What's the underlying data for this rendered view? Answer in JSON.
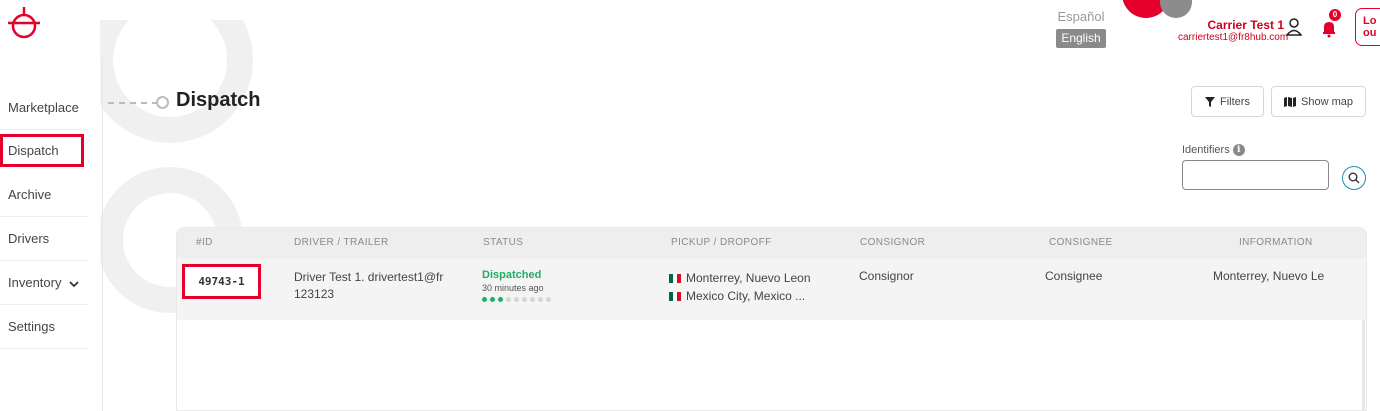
{
  "header": {
    "lang_es": "Español",
    "lang_en": "English",
    "user_name": "Carrier Test 1",
    "user_email": "carriertest1@fr8hub.com",
    "notification_count": "0",
    "logout_label": "Lo\nou"
  },
  "sidebar": {
    "items": [
      {
        "label": "Marketplace"
      },
      {
        "label": "Dispatch"
      },
      {
        "label": "Archive"
      },
      {
        "label": "Drivers"
      },
      {
        "label": "Inventory"
      },
      {
        "label": "Settings"
      }
    ]
  },
  "main": {
    "title": "Dispatch",
    "filters_label": "Filters",
    "map_label": "Show map",
    "identifiers_label": "Identifiers",
    "identifiers_value": ""
  },
  "table": {
    "headers": [
      "#ID",
      "DRIVER / TRAILER",
      "STATUS",
      "PICKUP / DROPOFF",
      "CONSIGNOR",
      "CONSIGNEE",
      "INFORMATION"
    ],
    "rows": [
      {
        "id": "49743-1",
        "driver": "Driver Test 1. drivertest1@fr",
        "trailer": "123123",
        "status": "Dispatched",
        "status_time": "30 minutes ago",
        "status_progress": 3,
        "status_steps": 9,
        "pickup": "Monterrey, Nuevo Leon",
        "dropoff": "Mexico City, Mexico ...",
        "consignor": "Consignor",
        "consignee": "Consignee",
        "information": "Monterrey, Nuevo Le"
      }
    ]
  },
  "colors": {
    "brand": "#e4002b",
    "status_green": "#1fae66",
    "search_blue": "#1b8fb5"
  }
}
